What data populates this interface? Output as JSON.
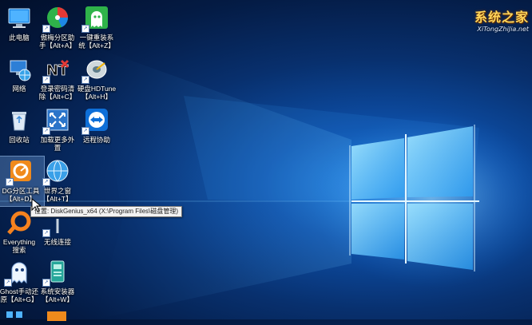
{
  "desktop": {
    "icons": [
      {
        "id": "this-pc",
        "label": "此电脑",
        "icon": "computer-icon"
      },
      {
        "id": "partition-assistant",
        "label": "傲梅分区助\n手【Alt+A】",
        "icon": "partition-disk-icon"
      },
      {
        "id": "one-click-reinstall",
        "label": "一键重装系\n统【Alt+Z】",
        "icon": "ghost-icon"
      },
      {
        "id": "network",
        "label": "网络",
        "icon": "network-globe-icon"
      },
      {
        "id": "clear-password",
        "label": "登录密码清\n除【Alt+C】",
        "icon": "nt-password-icon"
      },
      {
        "id": "hdtune",
        "label": "硬盘HDTune\n【Alt+H】",
        "icon": "hdtune-icon"
      },
      {
        "id": "recycle-bin",
        "label": "回收站",
        "icon": "recycle-bin-icon"
      },
      {
        "id": "load-peripherals",
        "label": "加载更多外\n置",
        "icon": "expand-arrows-icon"
      },
      {
        "id": "remote-assist",
        "label": "远程协助",
        "icon": "teamviewer-icon"
      },
      {
        "id": "diskgenius",
        "label": "DG分区工具\n【Alt+D】",
        "icon": "diskgenius-icon"
      },
      {
        "id": "world-window",
        "label": "世界之窗\n【Alt+T】",
        "icon": "browser-globe-icon"
      },
      {
        "id": "everything",
        "label": "Everything\n搜索",
        "icon": "everything-search-icon"
      },
      {
        "id": "wireless",
        "label": "无线连接",
        "icon": "wireless-antenna-icon"
      },
      {
        "id": "ghost-manual",
        "label": "Ghost手动还\n原【Alt+G】",
        "icon": "ghost-manual-icon"
      },
      {
        "id": "system-installer",
        "label": "系统安装器\n【Alt+W】",
        "icon": "installer-icon"
      }
    ],
    "tooltip": "位置: DiskGenius_x64 (X:\\Program Files\\磁盘管理)",
    "watermark": {
      "title": "系统之家",
      "subtitle": "XiTongZhiJia.net"
    }
  },
  "colors": {
    "accent_light": "#7fd0ff",
    "tooltip_bg": "#f2f2f2",
    "logo_gold": "#ffd55a"
  }
}
